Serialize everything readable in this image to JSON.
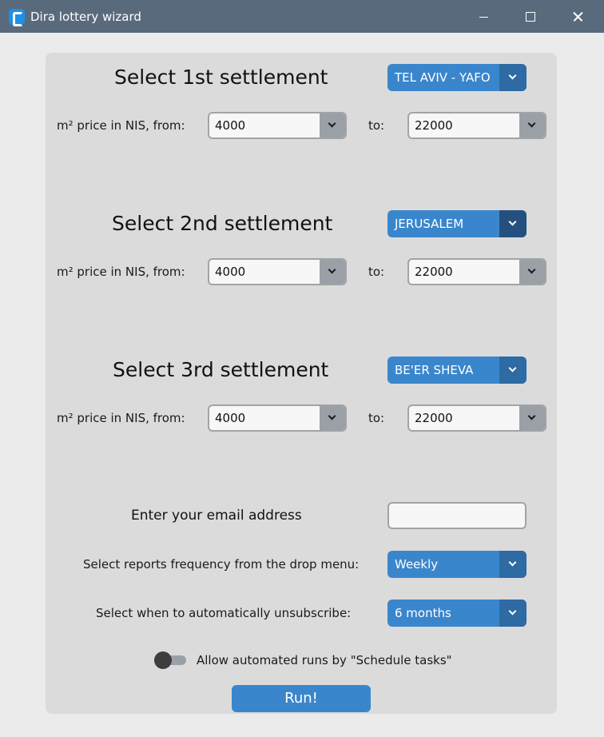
{
  "window": {
    "title": "Dira lottery wizard",
    "controls": [
      "minimize",
      "maximize",
      "close"
    ]
  },
  "settlements": [
    {
      "heading": "Select 1st settlement",
      "selected": "TEL AVIV - YAFO",
      "price_from_label": "m² price in NIS, from:",
      "price_from": "4000",
      "price_to_label": "to:",
      "price_to": "22000"
    },
    {
      "heading": "Select 2nd settlement",
      "selected": "JERUSALEM",
      "price_from_label": "m² price in NIS, from:",
      "price_from": "4000",
      "price_to_label": "to:",
      "price_to": "22000"
    },
    {
      "heading": "Select 3rd settlement",
      "selected": "BE'ER SHEVA",
      "price_from_label": "m² price in NIS, from:",
      "price_from": "4000",
      "price_to_label": "to:",
      "price_to": "22000"
    }
  ],
  "email": {
    "label": "Enter your email address",
    "value": ""
  },
  "frequency": {
    "label": "Select reports frequency from the drop menu:",
    "selected": "Weekly"
  },
  "unsubscribe": {
    "label": "Select when to automatically unsubscribe:",
    "selected": "6 months"
  },
  "schedule_toggle": {
    "label": "Allow automated runs by \"Schedule tasks\"",
    "on": false
  },
  "run_button": "Run!",
  "colors": {
    "titlebar": "#5a6a7d",
    "accent": "#3a86cc",
    "accent_dark": "#2e6aa3",
    "panel": "#dbdbdb",
    "background": "#ebebeb"
  }
}
